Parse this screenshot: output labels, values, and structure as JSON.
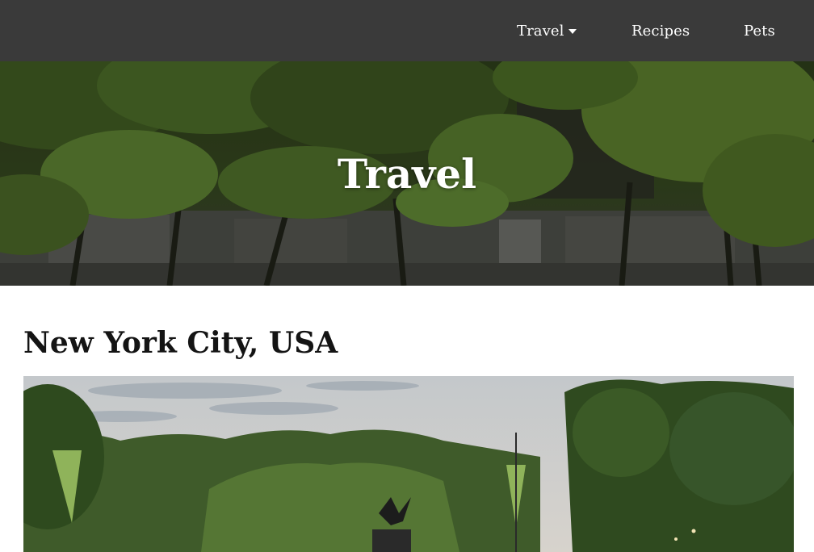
{
  "nav": {
    "items": [
      {
        "label": "Travel",
        "has_dropdown": true
      },
      {
        "label": "Recipes"
      },
      {
        "label": "Pets"
      }
    ]
  },
  "hero": {
    "title": "Travel"
  },
  "post": {
    "title": "New York City, USA"
  },
  "colors": {
    "navbar": "#3a3a3a",
    "nav_text": "#ffffff",
    "page_background": "#ffffff"
  },
  "icons": {
    "dropdown": "caret-down-icon"
  }
}
